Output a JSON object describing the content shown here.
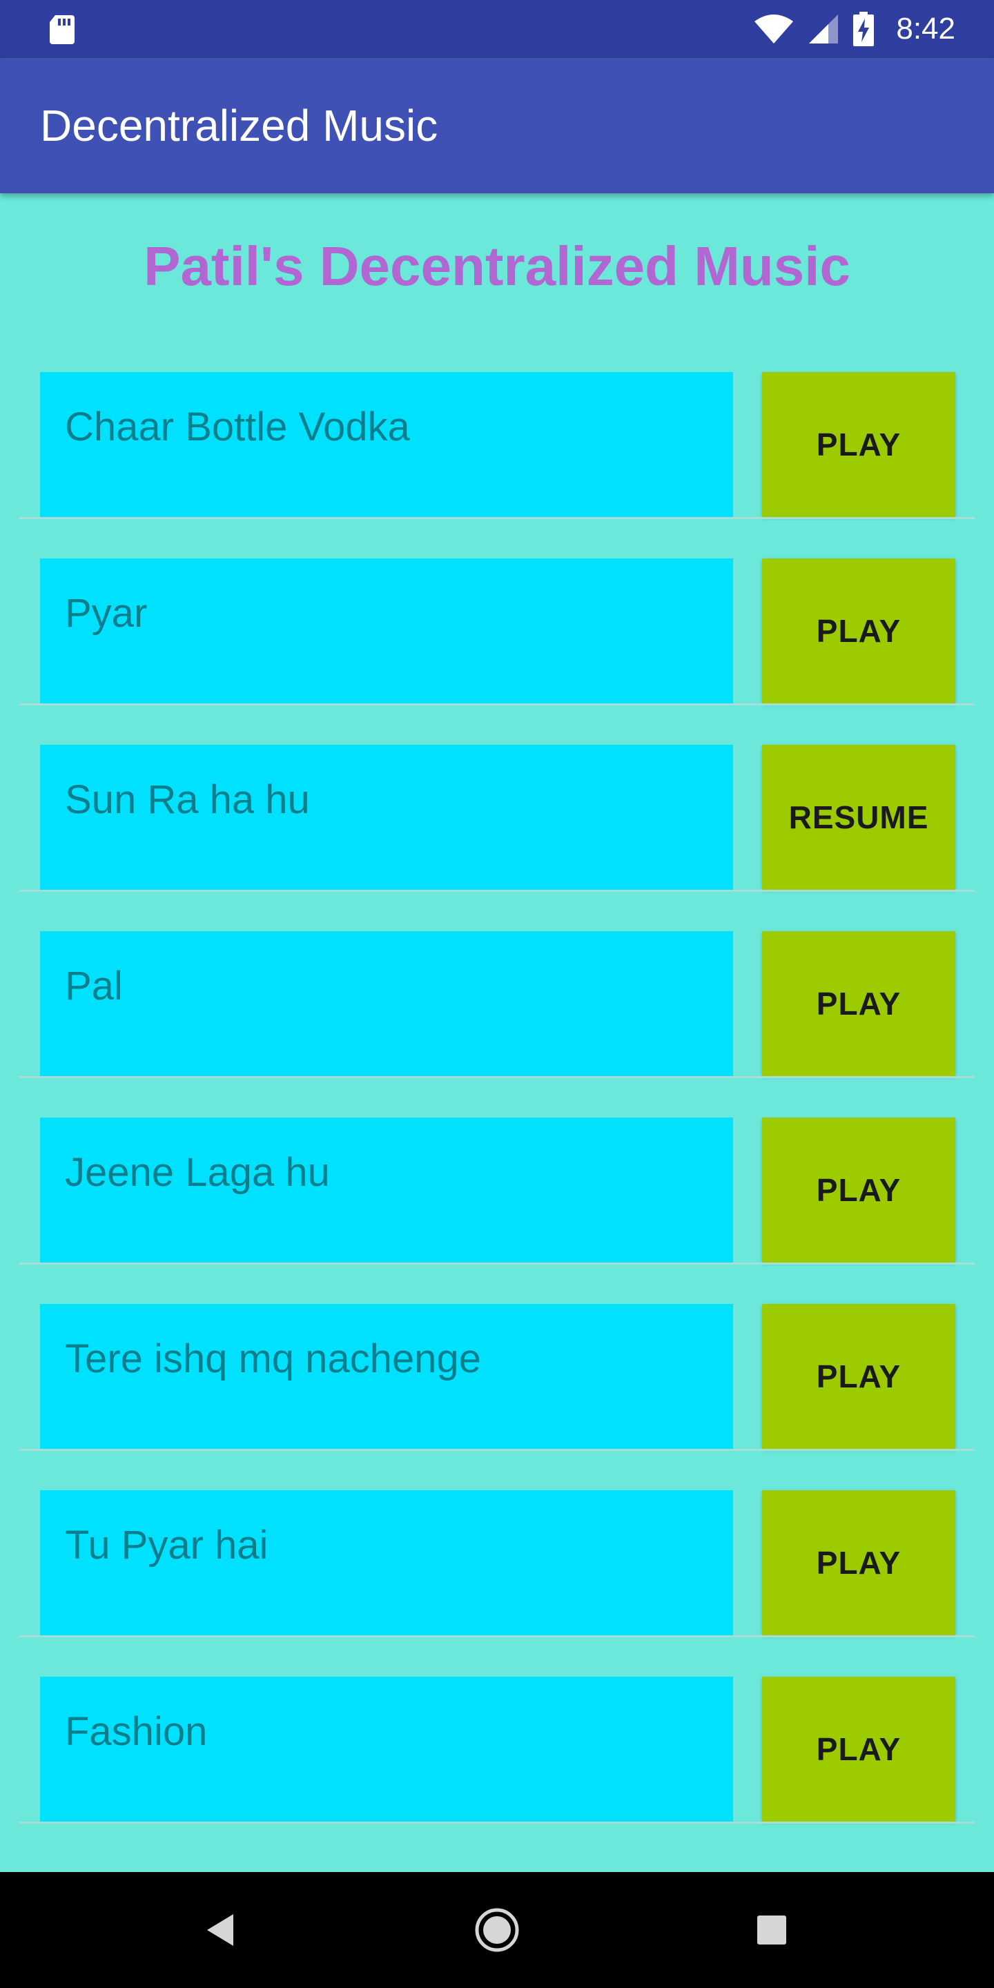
{
  "status_bar": {
    "time": "8:42",
    "icons": [
      "sd-card-icon",
      "wifi-icon",
      "cellular-signal-icon",
      "battery-charging-icon"
    ]
  },
  "app_bar": {
    "title": "Decentralized Music"
  },
  "heading": "Patil's Decentralized Music",
  "songs": [
    {
      "title": "Chaar Bottle Vodka",
      "button": "PLAY"
    },
    {
      "title": "Pyar",
      "button": "PLAY"
    },
    {
      "title": "Sun Ra ha hu",
      "button": "RESUME"
    },
    {
      "title": "Pal",
      "button": "PLAY"
    },
    {
      "title": "Jeene Laga hu",
      "button": "PLAY"
    },
    {
      "title": "Tere ishq mq nachenge",
      "button": "PLAY"
    },
    {
      "title": "Tu Pyar hai",
      "button": "PLAY"
    },
    {
      "title": "Fashion",
      "button": "PLAY"
    }
  ],
  "nav_bar": {
    "icons": [
      "back-icon",
      "home-icon",
      "recents-icon"
    ]
  },
  "colors": {
    "status_bar": "#303F9F",
    "app_bar": "#3F51B5",
    "background": "#6BE8DA",
    "heading": "#B266D1",
    "song_box": "#00E0FF",
    "song_text": "#0B7E8D",
    "button": "#9CCC00"
  }
}
